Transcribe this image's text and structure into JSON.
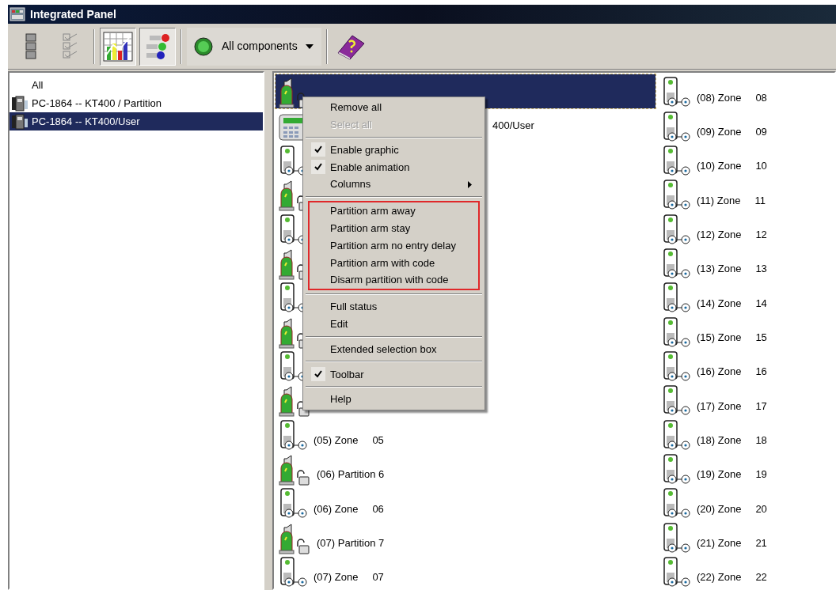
{
  "window": {
    "title": "Integrated Panel"
  },
  "toolbar": {
    "buttons": [
      {
        "kind": "list",
        "selected": false
      },
      {
        "kind": "checklist",
        "selected": false
      },
      {
        "kind": "chart",
        "selected": true
      },
      {
        "kind": "leds",
        "selected": true
      }
    ],
    "filter": {
      "value": "All components"
    },
    "help": {
      "kind": "book"
    }
  },
  "tree": [
    {
      "label": "All",
      "kind": "all",
      "selected": false
    },
    {
      "label": "PC-1864 -- KT400 / Partition",
      "kind": "panel",
      "selected": false
    },
    {
      "label": "PC-1864 -- KT400/User",
      "kind": "panel",
      "selected": true
    }
  ],
  "components": {
    "columns": [
      [
        {
          "kind": "partition",
          "selected": true
        },
        {
          "kind": "keypad",
          "selected": false,
          "label": "400/User"
        },
        {
          "kind": "zone",
          "selected": false
        },
        {
          "kind": "partition",
          "selected": false
        },
        {
          "kind": "zone",
          "selected": false
        },
        {
          "kind": "partition",
          "selected": false
        },
        {
          "kind": "zone",
          "selected": false
        },
        {
          "kind": "partition",
          "selected": false
        },
        {
          "kind": "zone",
          "selected": false
        },
        {
          "kind": "partition",
          "selected": false
        },
        {
          "kind": "zone",
          "selected": false,
          "label": "(05) Zone",
          "number": "05"
        },
        {
          "kind": "partition",
          "selected": false,
          "label": "(06) Partition 6"
        },
        {
          "kind": "zone",
          "selected": false,
          "label": "(06) Zone",
          "number": "06"
        },
        {
          "kind": "partition",
          "selected": false,
          "label": "(07) Partition 7"
        },
        {
          "kind": "zone",
          "selected": false,
          "label": "(07) Zone",
          "number": "07"
        }
      ],
      [
        {
          "kind": "zone",
          "selected": false,
          "label": "(08) Zone",
          "number": "08"
        },
        {
          "kind": "zone",
          "selected": false,
          "label": "(09) Zone",
          "number": "09"
        },
        {
          "kind": "zone",
          "selected": false,
          "label": "(10) Zone",
          "number": "10"
        },
        {
          "kind": "zone",
          "selected": false,
          "label": "(11) Zone",
          "number": "11"
        },
        {
          "kind": "zone",
          "selected": false,
          "label": "(12) Zone",
          "number": "12"
        },
        {
          "kind": "zone",
          "selected": false,
          "label": "(13) Zone",
          "number": "13"
        },
        {
          "kind": "zone",
          "selected": false,
          "label": "(14) Zone",
          "number": "14"
        },
        {
          "kind": "zone",
          "selected": false,
          "label": "(15) Zone",
          "number": "15"
        },
        {
          "kind": "zone",
          "selected": false,
          "label": "(16) Zone",
          "number": "16"
        },
        {
          "kind": "zone",
          "selected": false,
          "label": "(17) Zone",
          "number": "17"
        },
        {
          "kind": "zone",
          "selected": false,
          "label": "(18) Zone",
          "number": "18"
        },
        {
          "kind": "zone",
          "selected": false,
          "label": "(19) Zone",
          "number": "19"
        },
        {
          "kind": "zone",
          "selected": false,
          "label": "(20) Zone",
          "number": "20"
        },
        {
          "kind": "zone",
          "selected": false,
          "label": "(21) Zone",
          "number": "21"
        },
        {
          "kind": "zone",
          "selected": false,
          "label": "(22) Zone",
          "number": "22"
        }
      ]
    ]
  },
  "context_menu": {
    "groups": [
      {
        "highlighted": false,
        "items": [
          {
            "label": "Remove all",
            "checked": false,
            "disabled": false
          },
          {
            "label": "Select all",
            "checked": false,
            "disabled": true
          }
        ]
      },
      {
        "highlighted": false,
        "items": [
          {
            "label": "Enable graphic",
            "checked": true,
            "disabled": false
          },
          {
            "label": "Enable animation",
            "checked": true,
            "disabled": false
          },
          {
            "label": "Columns",
            "checked": false,
            "disabled": false,
            "submenu": true
          }
        ]
      },
      {
        "highlighted": true,
        "items": [
          {
            "label": "Partition arm away",
            "checked": false,
            "disabled": false
          },
          {
            "label": "Partition arm stay",
            "checked": false,
            "disabled": false
          },
          {
            "label": "Partition arm no entry delay",
            "checked": false,
            "disabled": false
          },
          {
            "label": "Partition arm with code",
            "checked": false,
            "disabled": false
          },
          {
            "label": "Disarm partition with code",
            "checked": false,
            "disabled": false
          }
        ]
      },
      {
        "highlighted": false,
        "items": [
          {
            "label": "Full status",
            "checked": false,
            "disabled": false
          },
          {
            "label": "Edit",
            "checked": false,
            "disabled": false
          }
        ]
      },
      {
        "highlighted": false,
        "items": [
          {
            "label": "Extended selection box",
            "checked": false,
            "disabled": false
          }
        ]
      },
      {
        "highlighted": false,
        "items": [
          {
            "label": "Toolbar",
            "checked": true,
            "disabled": false
          }
        ]
      },
      {
        "highlighted": false,
        "items": [
          {
            "label": "Help",
            "checked": false,
            "disabled": false
          }
        ]
      }
    ]
  }
}
